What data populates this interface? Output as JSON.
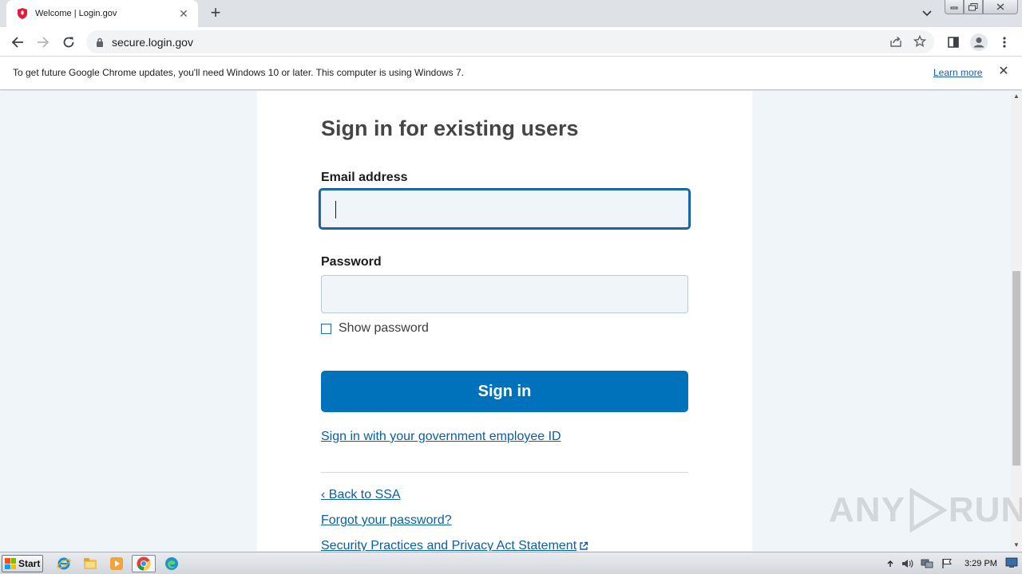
{
  "browser": {
    "tab_title": "Welcome | Login.gov",
    "tab_close": "✕",
    "new_tab": "+",
    "url": "secure.login.gov",
    "icons": [
      "back-arrow-icon",
      "forward-arrow-icon",
      "reload-icon",
      "lock-icon",
      "share-icon",
      "star-icon",
      "side-panel-icon",
      "profile-icon",
      "menu-dots-icon"
    ]
  },
  "infobar": {
    "message": "To get future Google Chrome updates, you'll need Windows 10 or later. This computer is using Windows 7.",
    "learn_more": "Learn more",
    "close": "✕"
  },
  "form": {
    "heading": "Sign in for existing users",
    "email_label": "Email address",
    "password_label": "Password",
    "show_password": "Show password",
    "submit": "Sign in",
    "piv_link": "Sign in with your government employee ID",
    "back_link": "‹ Back to SSA",
    "forgot_link": "Forgot your password?",
    "security_link": "Security Practices and Privacy Act Statement"
  },
  "watermark": {
    "left": "ANY",
    "right": "RUN"
  },
  "taskbar": {
    "start": "Start",
    "clock": "3:29 PM"
  },
  "colors": {
    "primary_button": "#0071bb",
    "link": "#0b5ea8",
    "page_background": "#f0f5fa",
    "focus_border": "#1e6fb1"
  }
}
